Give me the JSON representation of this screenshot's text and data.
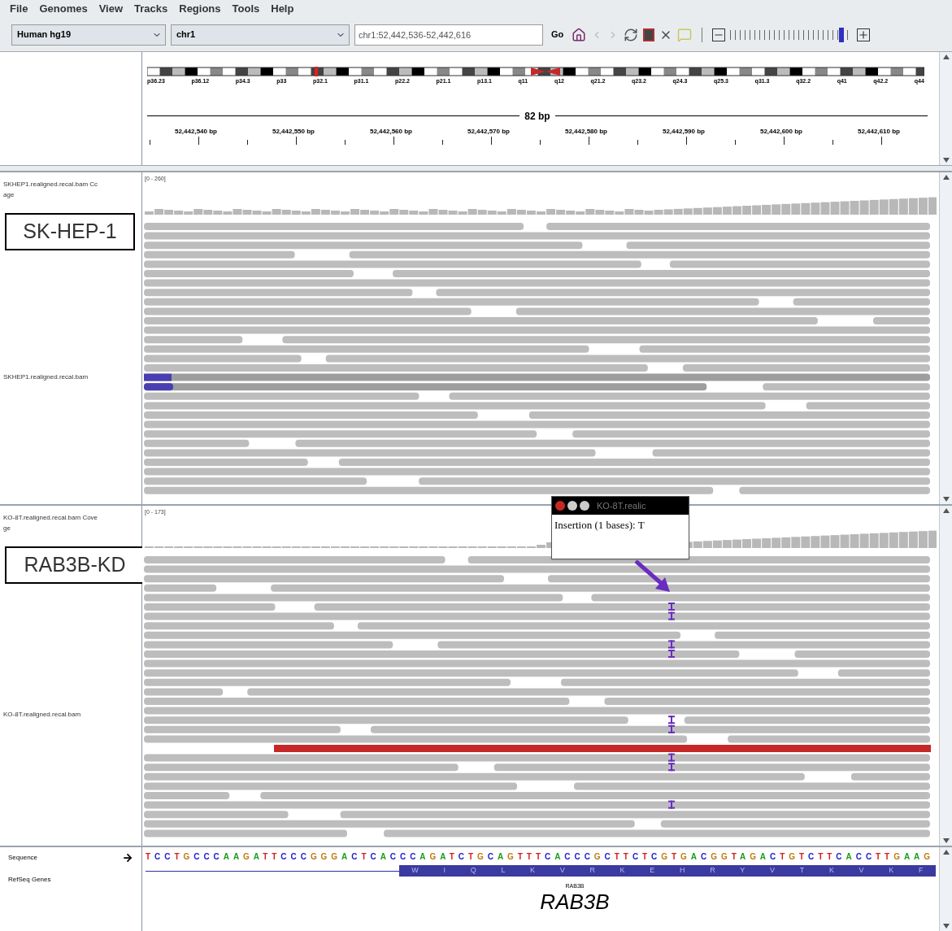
{
  "menu": [
    "File",
    "Genomes",
    "View",
    "Tracks",
    "Regions",
    "Tools",
    "Help"
  ],
  "toolbar": {
    "genome": "Human hg19",
    "chromosome": "chr1",
    "locus": "chr1:52,442,536-52,442,616",
    "go": "Go",
    "zoom": {
      "level": 0.93
    }
  },
  "ideogram": {
    "bands": [
      "p36.23",
      "p36.12",
      "p34.3",
      "p33",
      "p32.1",
      "p31.1",
      "p22.2",
      "p21.1",
      "p13.1",
      "q11",
      "q12",
      "q21.2",
      "q23.2",
      "q24.3",
      "q25.3",
      "q31.3",
      "q32.2",
      "q41",
      "q42.2",
      "q44"
    ]
  },
  "ruler": {
    "span": "82 bp",
    "ticks": [
      "52,442,540 bp",
      "52,442,550 bp",
      "52,442,560 bp",
      "52,442,570 bp",
      "52,442,580 bp",
      "52,442,590 bp",
      "52,442,600 bp",
      "52,442,610 bp"
    ]
  },
  "tracks": [
    {
      "coverage_name": [
        "SKHEP1.realigned.recal.bam Cc",
        "age"
      ],
      "range": "[0 - 260]",
      "sample_label": "SK-HEP-1",
      "alignment_name": "SKHEP1.realigned.recal.bam",
      "insertions": false
    },
    {
      "coverage_name": [
        "KO-8T.realigned.recal.bam Cove",
        "ge"
      ],
      "range": "[0 - 173]",
      "sample_label": "RAB3B-KD",
      "alignment_name": "KO-8T.realigned.recal.bam",
      "insertions": true
    }
  ],
  "popup": {
    "title": "KO-8T.realic",
    "text": "Insertion (1 bases): T"
  },
  "sequence": {
    "label": "Sequence",
    "bases": "TCCTGCCCAAGATTCCCGGGACTCACCCAGATCTGCAGTTTCACCCGCTTCTCGTGACGGTAGACTGTCTTCACCTTGAAG"
  },
  "refseq": {
    "label": "RefSeq Genes",
    "amino_acids": [
      "W",
      "I",
      "Q",
      "L",
      "K",
      "V",
      "R",
      "K",
      "E",
      "H",
      "R",
      "Y",
      "V",
      "T",
      "K",
      "V",
      "K",
      "F"
    ],
    "gene": "RAB3B",
    "annotation": "RAB3B"
  }
}
